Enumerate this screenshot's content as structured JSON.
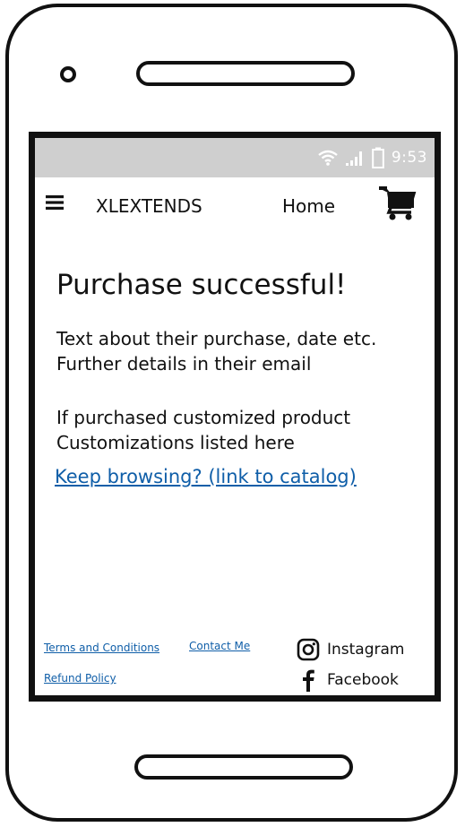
{
  "status_bar": {
    "time": "9:53",
    "wifi_icon": "wifi-icon",
    "signal_icon": "signal-icon",
    "battery_icon": "battery-icon"
  },
  "header": {
    "menu_icon": "menu-icon",
    "brand": "XLEXTENDS",
    "home_label": "Home",
    "cart_icon": "cart-icon"
  },
  "main": {
    "title": "Purchase successful!",
    "paragraph1_line1": "Text about their purchase, date etc.",
    "paragraph1_line2": "Further details in their email",
    "paragraph2_line1": "If purchased customized product",
    "paragraph2_line2": "Customizations listed here",
    "catalog_link": "Keep browsing? (link to catalog)"
  },
  "footer": {
    "terms": "Terms and Conditions",
    "contact": "Contact Me",
    "refund": "Refund Policy",
    "instagram": "Instagram",
    "facebook": "Facebook"
  },
  "colors": {
    "link": "#0f5ea8",
    "status_bar_bg": "#cfcfcf",
    "frame": "#111111"
  }
}
